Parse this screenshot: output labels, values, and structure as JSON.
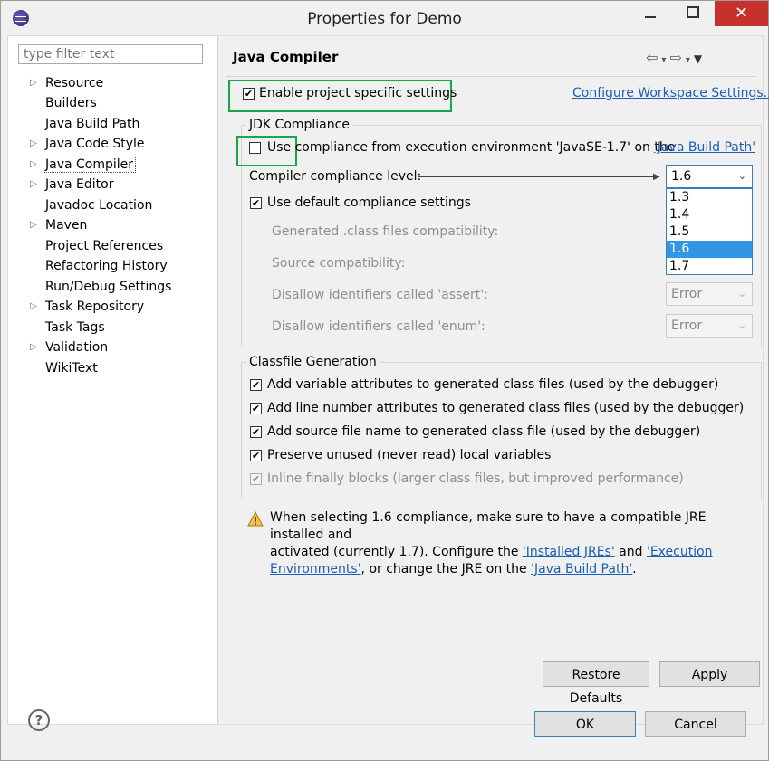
{
  "window": {
    "title": "Properties for Demo"
  },
  "filter": {
    "placeholder": "type filter text"
  },
  "tree": [
    {
      "label": "Resource",
      "expandable": true
    },
    {
      "label": "Builders",
      "expandable": false
    },
    {
      "label": "Java Build Path",
      "expandable": false
    },
    {
      "label": "Java Code Style",
      "expandable": true
    },
    {
      "label": "Java Compiler",
      "expandable": true,
      "selected": true
    },
    {
      "label": "Java Editor",
      "expandable": true
    },
    {
      "label": "Javadoc Location",
      "expandable": false
    },
    {
      "label": "Maven",
      "expandable": true
    },
    {
      "label": "Project References",
      "expandable": false
    },
    {
      "label": "Refactoring History",
      "expandable": false
    },
    {
      "label": "Run/Debug Settings",
      "expandable": false
    },
    {
      "label": "Task Repository",
      "expandable": true
    },
    {
      "label": "Task Tags",
      "expandable": false
    },
    {
      "label": "Validation",
      "expandable": true
    },
    {
      "label": "WikiText",
      "expandable": false
    }
  ],
  "page": {
    "title": "Java Compiler",
    "enable_specific": "Enable project specific settings",
    "configure_link": "Configure Workspace Settings...",
    "jdk_group": "JDK Compliance",
    "use_env_compliance": "Use compliance from execution environment 'JavaSE-1.7' on the",
    "java_build_path_link": "'Java Build Path'",
    "compliance_level_label": "Compiler compliance level:",
    "compliance_level_value": "1.6",
    "compliance_options": [
      "1.3",
      "1.4",
      "1.5",
      "1.6",
      "1.7"
    ],
    "use_default_compliance": "Use default compliance settings",
    "generated_class_label": "Generated .class files compatibility:",
    "source_compat_label": "Source compatibility:",
    "disallow_assert_label": "Disallow identifiers called 'assert':",
    "disallow_assert_value": "Error",
    "disallow_enum_label": "Disallow identifiers called 'enum':",
    "disallow_enum_value": "Error",
    "classfile_group": "Classfile Generation",
    "cf_variable": "Add variable attributes to generated class files (used by the debugger)",
    "cf_line": "Add line number attributes to generated class files (used by the debugger)",
    "cf_source": "Add source file name to generated class file (used by the debugger)",
    "cf_preserve": "Preserve unused (never read) local variables",
    "cf_inline": "Inline finally blocks (larger class files, but improved performance)",
    "warn_1": "When selecting 1.6 compliance, make sure to have a compatible JRE installed and",
    "warn_2a": "activated (currently 1.7). Configure the",
    "warn_link_jres": "'Installed JREs'",
    "warn_and": "and",
    "warn_link_exec_1": "'Execution",
    "warn_link_exec_2": "Environments'",
    "warn_3a": ", or change the JRE on the",
    "warn_link_jbp": "'Java Build Path'",
    "warn_dot": ".",
    "restore_defaults": "Restore Defaults",
    "apply": "Apply"
  },
  "footer": {
    "ok": "OK",
    "cancel": "Cancel",
    "help": "?"
  },
  "colors": {
    "highlight": "#1aa64a",
    "selection": "#3296e6",
    "link": "#1a5fb4",
    "close": "#c7312c"
  }
}
